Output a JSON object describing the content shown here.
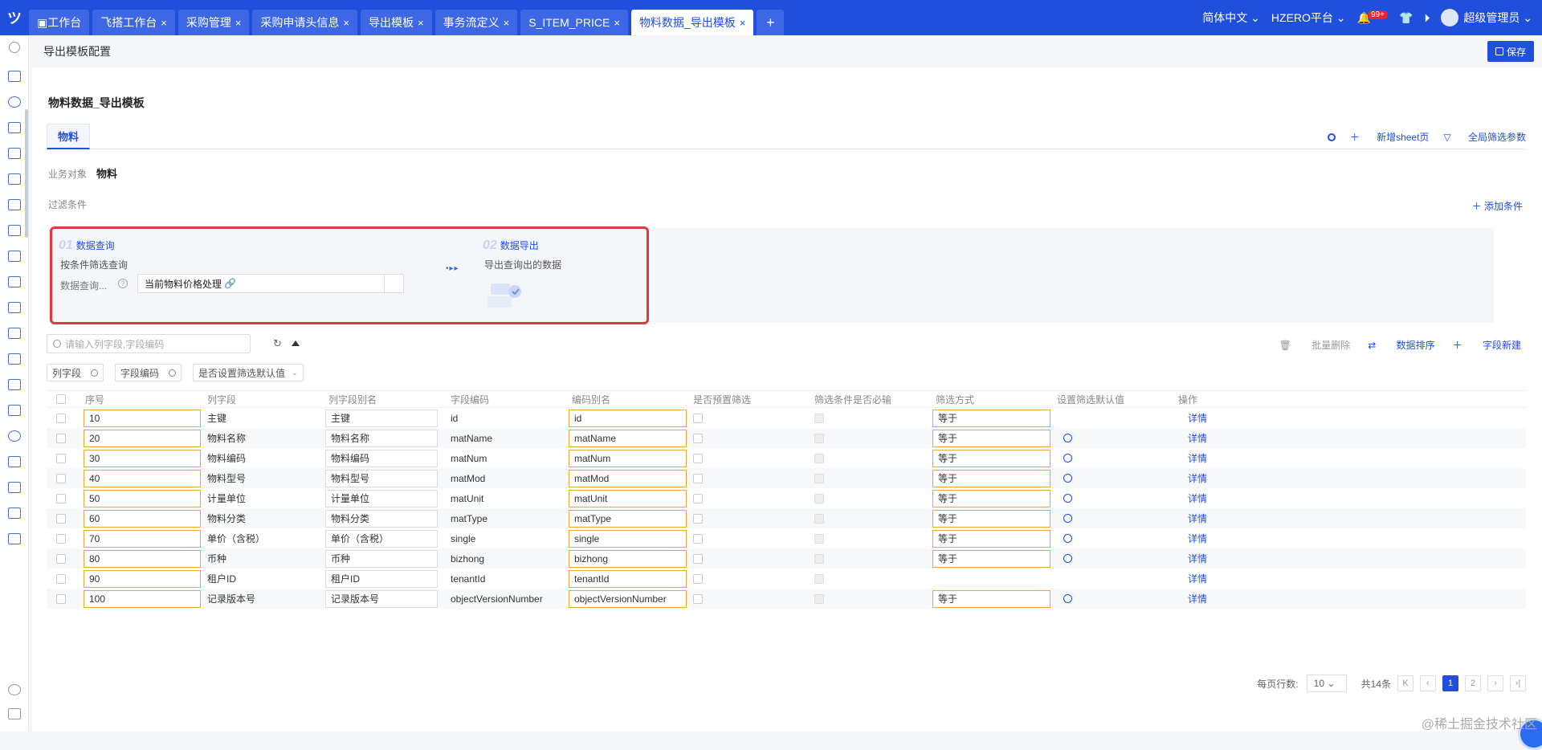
{
  "topbar": {
    "tabs": [
      {
        "label": "工作台",
        "closable": false,
        "active": false
      },
      {
        "label": "飞搭工作台",
        "closable": true,
        "active": false
      },
      {
        "label": "采购管理",
        "closable": true,
        "active": false
      },
      {
        "label": "采购申请头信息",
        "closable": true,
        "active": false
      },
      {
        "label": "导出模板",
        "closable": true,
        "active": false
      },
      {
        "label": "事务流定义",
        "closable": true,
        "active": false
      },
      {
        "label": "S_ITEM_PRICE",
        "closable": true,
        "active": false
      },
      {
        "label": "物料数据_导出模板",
        "closable": true,
        "active": true
      }
    ],
    "add_tab": "+",
    "close_glyph": "×",
    "language": "简体中文",
    "platform": "HZERO平台",
    "notif_badge": "99+",
    "user": "超级管理员"
  },
  "subheader": {
    "title": "导出模板配置",
    "save_label": "保存"
  },
  "page": {
    "title": "物料数据_导出模板"
  },
  "sheet": {
    "tab_label": "物料",
    "add_sheet": "新增sheet页",
    "global_filter": "全局筛选参数"
  },
  "business_object": {
    "label": "业务对象",
    "value": "物料"
  },
  "filter": {
    "label": "过滤条件",
    "add": "添加条件"
  },
  "flow": {
    "step1": {
      "num": "01",
      "title": "数据查询",
      "desc": "按条件筛选查询",
      "query_label": "数据查询...",
      "help": "?",
      "query_value": "当前物料价格处理"
    },
    "step2": {
      "num": "02",
      "title": "数据导出",
      "desc": "导出查询出的数据"
    }
  },
  "toolbar": {
    "search_placeholder": "请输入列字段,字段编码",
    "batch_delete": "批量删除",
    "sort": "数据排序",
    "new_field": "字段新建"
  },
  "filters": {
    "col_field": "列字段",
    "field_code": "字段编码",
    "preset": "是否设置筛选默认值"
  },
  "table": {
    "headers": [
      "序号",
      "列字段",
      "列字段别名",
      "字段编码",
      "编码别名",
      "是否预置筛选",
      "筛选条件是否必输",
      "筛选方式",
      "设置筛选默认值",
      "操作"
    ],
    "rows": [
      {
        "seq": "10",
        "field": "主键",
        "alias": "主键",
        "code": "id",
        "code_alias": "id",
        "mode": "等于",
        "cog": false,
        "action": "详情"
      },
      {
        "seq": "20",
        "field": "物料名称",
        "alias": "物料名称",
        "code": "matName",
        "code_alias": "matName",
        "mode": "等于",
        "cog": true,
        "action": "详情"
      },
      {
        "seq": "30",
        "field": "物料编码",
        "alias": "物料编码",
        "code": "matNum",
        "code_alias": "matNum",
        "mode": "等于",
        "cog": true,
        "action": "详情"
      },
      {
        "seq": "40",
        "field": "物料型号",
        "alias": "物料型号",
        "code": "matMod",
        "code_alias": "matMod",
        "mode": "等于",
        "cog": true,
        "action": "详情"
      },
      {
        "seq": "50",
        "field": "计量单位",
        "alias": "计量单位",
        "code": "matUnit",
        "code_alias": "matUnit",
        "mode": "等于",
        "cog": true,
        "action": "详情"
      },
      {
        "seq": "60",
        "field": "物料分类",
        "alias": "物料分类",
        "code": "matType",
        "code_alias": "matType",
        "mode": "等于",
        "cog": true,
        "action": "详情"
      },
      {
        "seq": "70",
        "field": "单价（含税）",
        "alias": "单价（含税）",
        "code": "single",
        "code_alias": "single",
        "mode": "等于",
        "cog": true,
        "action": "详情"
      },
      {
        "seq": "80",
        "field": "币种",
        "alias": "币种",
        "code": "bizhong",
        "code_alias": "bizhong",
        "mode": "等于",
        "cog": true,
        "action": "详情"
      },
      {
        "seq": "90",
        "field": "租户ID",
        "alias": "租户ID",
        "code": "tenantId",
        "code_alias": "tenantId",
        "mode": "",
        "cog": false,
        "action": "详情"
      },
      {
        "seq": "100",
        "field": "记录版本号",
        "alias": "记录版本号",
        "code": "objectVersionNumber",
        "code_alias": "objectVersionNumber",
        "mode": "等于",
        "cog": true,
        "action": "详情"
      }
    ]
  },
  "pager": {
    "page_size_label": "每页行数:",
    "page_size": "10",
    "total": "共14条",
    "pages": [
      "1",
      "2"
    ],
    "current": "1"
  },
  "watermark": "@稀土掘金技术社区"
}
